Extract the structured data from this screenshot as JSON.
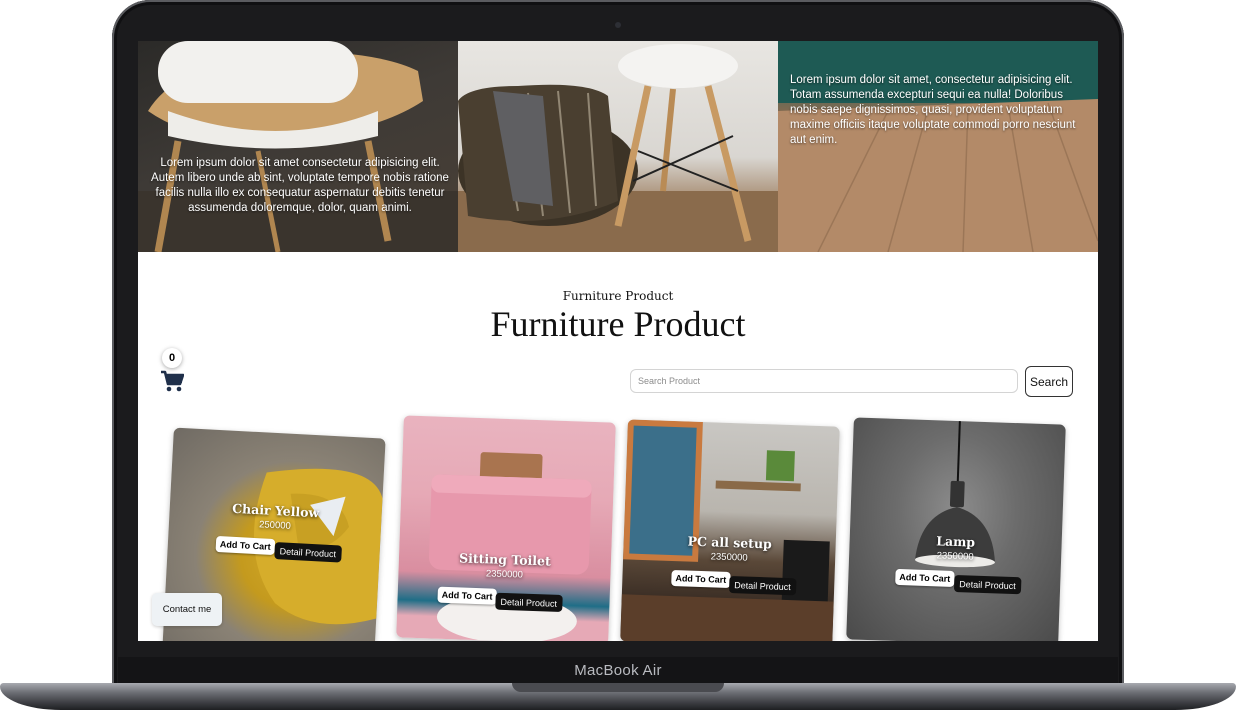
{
  "device": {
    "label": "MacBook Air"
  },
  "hero": {
    "panel1_text": "Lorem ipsum dolor sit amet consectetur adipisicing elit. Autem libero unde ab sint, voluptate tempore nobis ratione facilis nulla illo ex consequatur aspernatur debitis tenetur assumenda doloremque, dolor, quam animi.",
    "panel3_text": "Lorem ipsum dolor sit amet, consectetur adipisicing elit. Totam assumenda excepturi sequi ea nulla! Doloribus nobis saepe dignissimos, quasi, provident voluptatum maxime officiis itaque voluptate commodi porro nesciunt aut enim."
  },
  "section": {
    "subtitle": "Furniture Product",
    "title": "Furniture Product"
  },
  "cart": {
    "count": "0"
  },
  "search": {
    "placeholder": "Search Product",
    "button_label": "Search"
  },
  "products": [
    {
      "name": "Chair Yellow",
      "price": "250000",
      "add_label": "Add To Cart",
      "detail_label": "Detail Product"
    },
    {
      "name": "Sitting Toilet",
      "price": "2350000",
      "add_label": "Add To Cart",
      "detail_label": "Detail Product"
    },
    {
      "name": "PC all setup",
      "price": "2350000",
      "add_label": "Add To Cart",
      "detail_label": "Detail Product"
    },
    {
      "name": "Lamp",
      "price": "2350000",
      "add_label": "Add To Cart",
      "detail_label": "Detail Product"
    }
  ],
  "contact": {
    "label": "Contact me"
  },
  "colors": {
    "bezel": "#1b1b1d",
    "detail_button": "#111111",
    "page_bg": "#ffffff"
  }
}
